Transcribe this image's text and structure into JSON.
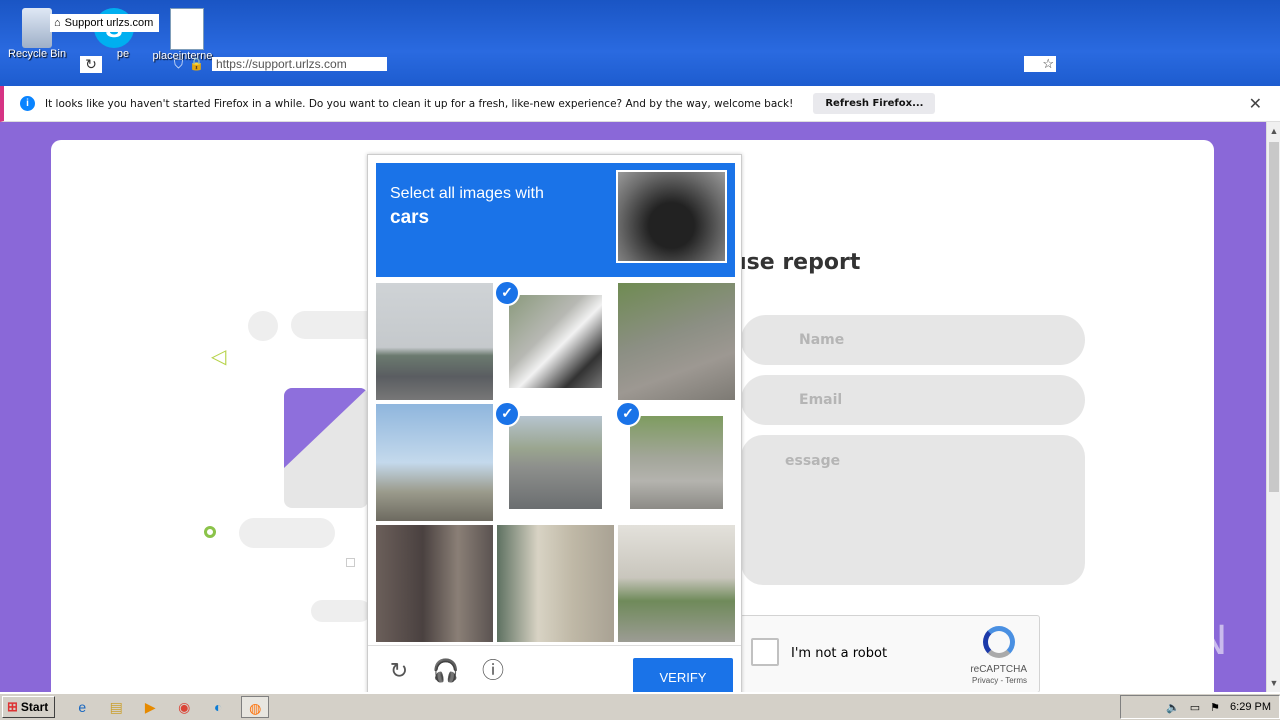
{
  "desktop": {
    "icons": [
      {
        "label": "Recycle Bin"
      },
      {
        "label": "pe"
      },
      {
        "label": "placeinterne..."
      }
    ]
  },
  "browser": {
    "tab_title": "Support urlzs.com",
    "url": "https://support.urlzs.com"
  },
  "notification": {
    "text": "It looks like you haven't started Firefox in a while. Do you want to clean it up for a fresh, like-new experience? And by the way, welcome back!",
    "button": "Refresh Firefox...",
    "close": "✕"
  },
  "page": {
    "title_fragment": "use report",
    "name_placeholder": "Name",
    "email_placeholder": "Email",
    "message_placeholder": "essage"
  },
  "recaptcha": {
    "not_robot": "I'm not a robot",
    "brand": "reCAPTCHA",
    "links": "Privacy - Terms"
  },
  "challenge": {
    "line1": "Select all images with",
    "target": "cars",
    "verify": "VERIFY",
    "tiles": [
      {
        "selected": false
      },
      {
        "selected": true
      },
      {
        "selected": false
      },
      {
        "selected": false
      },
      {
        "selected": true
      },
      {
        "selected": true
      },
      {
        "selected": false
      },
      {
        "selected": false
      },
      {
        "selected": false
      }
    ]
  },
  "watermark": "ANY RUN",
  "taskbar": {
    "start": "Start",
    "time": "6:29 PM"
  }
}
